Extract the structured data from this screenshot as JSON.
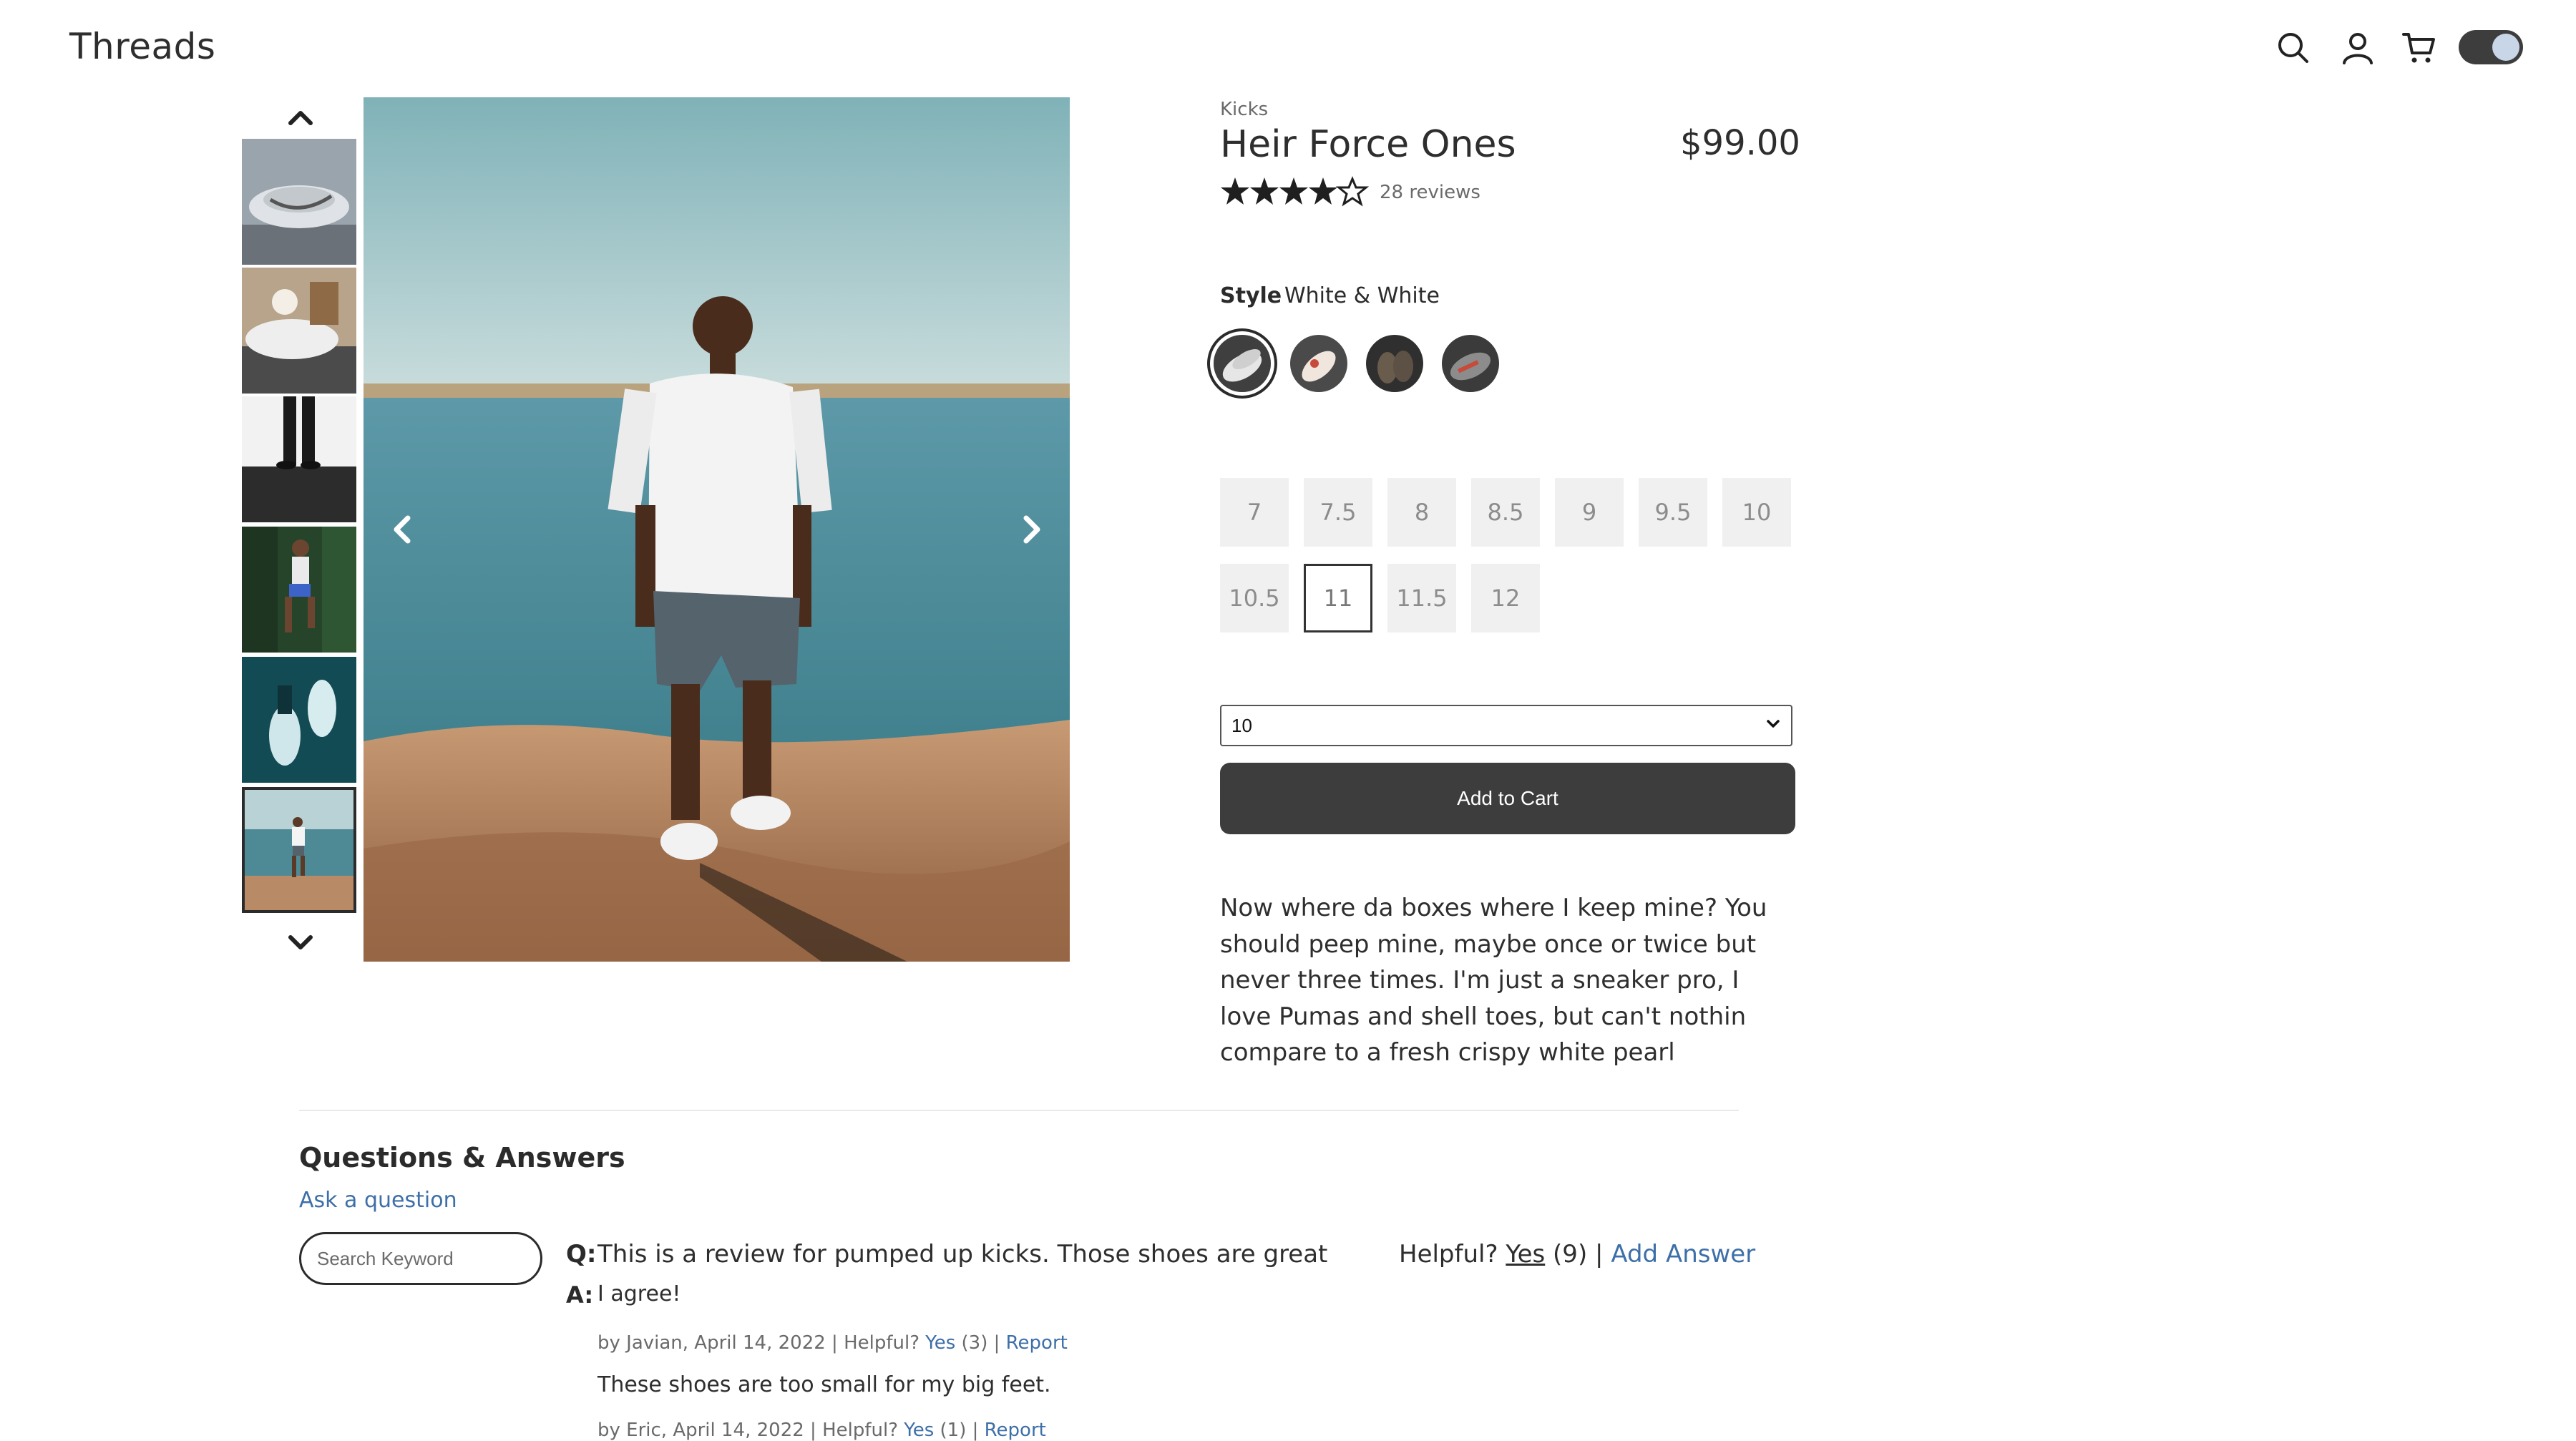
{
  "header": {
    "logo": "Threads",
    "icons": [
      "search-icon",
      "user-icon",
      "cart-icon"
    ],
    "theme_toggle": "on"
  },
  "gallery": {
    "thumbnail_count": 6,
    "selected_thumbnail": 6
  },
  "product": {
    "category": "Kicks",
    "name": "Heir Force Ones",
    "price": "$99.00",
    "rating": 4,
    "max_rating": 5,
    "reviews": "28 reviews",
    "style_label": "Style",
    "style_value": "White & White",
    "styles_count": 4,
    "selected_style": 1,
    "sizes": [
      "7",
      "7.5",
      "8",
      "8.5",
      "9",
      "9.5",
      "10",
      "10.5",
      "11",
      "11.5",
      "12"
    ],
    "selected_size": "11",
    "quantity": "10",
    "add_to_cart": "Add to Cart",
    "description": "Now where da boxes where I keep mine? You should peep mine, maybe once or twice but never three times. I'm just a sneaker pro, I love Pumas and shell toes, but can't nothin compare to a fresh crispy white pearl"
  },
  "qa": {
    "title": "Questions & Answers",
    "ask_link": "Ask a question",
    "search_placeholder": "Search Keyword",
    "question": {
      "prefix": "Q:",
      "text": "This is a review for pumped up kicks. Those shoes are great",
      "helpful_label": "Helpful?",
      "yes": "Yes",
      "yes_count": "(9)",
      "separator": "|",
      "add_answer": "Add Answer"
    },
    "answers": [
      {
        "prefix": "A:",
        "text": "I agree!",
        "by": "by Javian, April 14, 2022 | Helpful?",
        "yes": "Yes",
        "count": "(3) |",
        "report": "Report"
      },
      {
        "text": "These shoes are too small for my big feet.",
        "by": "by Eric, April 14, 2022 | Helpful?",
        "yes": "Yes",
        "count": "(1) |",
        "report": "Report"
      }
    ]
  },
  "colors": {
    "accent_link": "#3d6fa8",
    "dark": "#3d3d3d",
    "size_bg": "#f0f0f0"
  }
}
